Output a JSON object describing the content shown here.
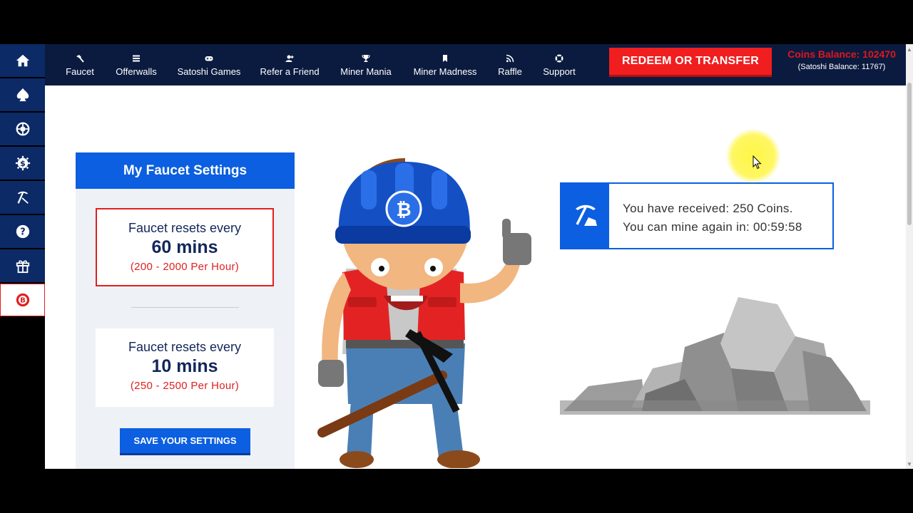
{
  "nav": {
    "items": [
      {
        "label": "Faucet",
        "icon": "hammer-icon"
      },
      {
        "label": "Offerwalls",
        "icon": "list-icon"
      },
      {
        "label": "Satoshi Games",
        "icon": "gamepad-icon"
      },
      {
        "label": "Refer a Friend",
        "icon": "user-plus-icon"
      },
      {
        "label": "Miner Mania",
        "icon": "trophy-icon"
      },
      {
        "label": "Miner Madness",
        "icon": "bookmark-icon"
      },
      {
        "label": "Raffle",
        "icon": "rss-icon"
      },
      {
        "label": "Support",
        "icon": "lifebuoy-icon"
      }
    ],
    "redeem_label": "REDEEM OR TRANSFER",
    "coins_label": "Coins Balance:",
    "coins_value": "102470",
    "satoshi_balance": "(Satoshi Balance: 11767)"
  },
  "sidebar": {
    "icons": [
      "home-icon",
      "spade-icon",
      "roulette-icon",
      "dollar-gear-icon",
      "pickaxe-icon",
      "help-icon",
      "gift-icon",
      "brand-logo-icon"
    ]
  },
  "settings": {
    "title": "My Faucet Settings",
    "options": [
      {
        "line1": "Faucet resets every",
        "line2": "60 mins",
        "line3": "(200 - 2000 Per Hour)",
        "selected": true
      },
      {
        "line1": "Faucet resets every",
        "line2": "10 mins",
        "line3": "(250 - 2500 Per Hour)",
        "selected": false
      }
    ],
    "save_label": "SAVE YOUR SETTINGS"
  },
  "notice": {
    "line1": "You have received: 250 Coins.",
    "line2": "You can mine again in: 00:59:58"
  },
  "colors": {
    "nav_bg": "#0b1b3f",
    "primary_blue": "#0b5fe0",
    "accent_red": "#e02020"
  }
}
